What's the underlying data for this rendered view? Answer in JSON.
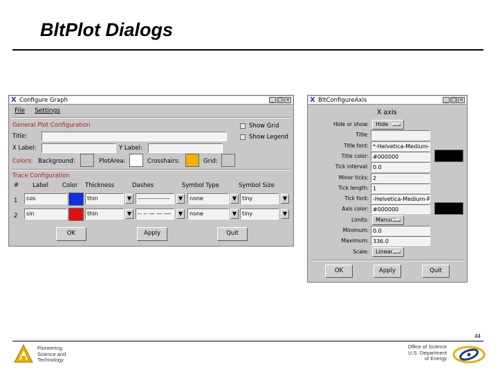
{
  "slide": {
    "title": "BltPlot Dialogs",
    "page_number": "44"
  },
  "footer": {
    "left_lines": [
      "Pioneering",
      "Science and",
      "Technology"
    ],
    "right_lines": [
      "Office of Science",
      "U.S. Department",
      "of Energy"
    ]
  },
  "configure_graph": {
    "window_title": "Configure Graph",
    "menu": [
      "File",
      "Settings"
    ],
    "general_section": "General Plot Configuration",
    "title_label": "Title:",
    "show_grid": "Show Grid",
    "show_legend": "Show Legend",
    "xlabel_label": "X Label:",
    "ylabel_label": "Y Label:",
    "colors_label": "Colors:",
    "background_label": "Background:",
    "plotarea_label": "PlotArea:",
    "crosshairs_label": "Crosshairs:",
    "grid_label": "Grid:",
    "colors": {
      "background": "#c8c8c8",
      "plotarea": "#ffffff",
      "crosshairs": "#f0b400",
      "grid": "#c8c8c8"
    },
    "trace_section": "Trace Configuration",
    "trace_headers": [
      "#",
      "Label",
      "Color",
      "Thickness",
      "Dashes",
      "Symbol Type",
      "Symbol Size"
    ],
    "traces": [
      {
        "num": "1",
        "label": "cos",
        "color": "#1030e0",
        "thickness": "thin",
        "dashes": "----------------",
        "symbol_type": "none",
        "symbol_size": "tiny"
      },
      {
        "num": "2",
        "label": "sin",
        "color": "#e01010",
        "thickness": "thin",
        "dashes": "-- -- — — —-",
        "symbol_type": "none",
        "symbol_size": "tiny"
      }
    ],
    "buttons": {
      "ok": "OK",
      "apply": "Apply",
      "quit": "Quit"
    }
  },
  "configure_axis": {
    "window_title": "BltConfigureAxis",
    "heading": "X axis",
    "rows": [
      {
        "label": "Hide or show:",
        "kind": "option",
        "value": "Hide"
      },
      {
        "label": "Title:",
        "kind": "field",
        "value": ""
      },
      {
        "label": "Title font:",
        "kind": "field",
        "value": "*-Helvetica-Medium-R"
      },
      {
        "label": "Title color:",
        "kind": "color",
        "value": "#000000"
      },
      {
        "label": "Tick interval:",
        "kind": "field",
        "value": "0.0"
      },
      {
        "label": "Minor ticks:",
        "kind": "field",
        "value": "2"
      },
      {
        "label": "Tick length:",
        "kind": "field",
        "value": "1"
      },
      {
        "label": "Tick font:",
        "kind": "field",
        "value": "-Helvetica-Medium-R-"
      },
      {
        "label": "Axis color:",
        "kind": "color",
        "value": "#000000"
      },
      {
        "label": "Limits:",
        "kind": "option",
        "value": "Manual"
      },
      {
        "label": "Minimum:",
        "kind": "field",
        "value": "0.0"
      },
      {
        "label": "Maximum:",
        "kind": "field",
        "value": "336.0"
      },
      {
        "label": "Scale:",
        "kind": "option",
        "value": "Linear"
      }
    ],
    "buttons": {
      "ok": "OK",
      "apply": "Apply",
      "quit": "Quit"
    }
  }
}
